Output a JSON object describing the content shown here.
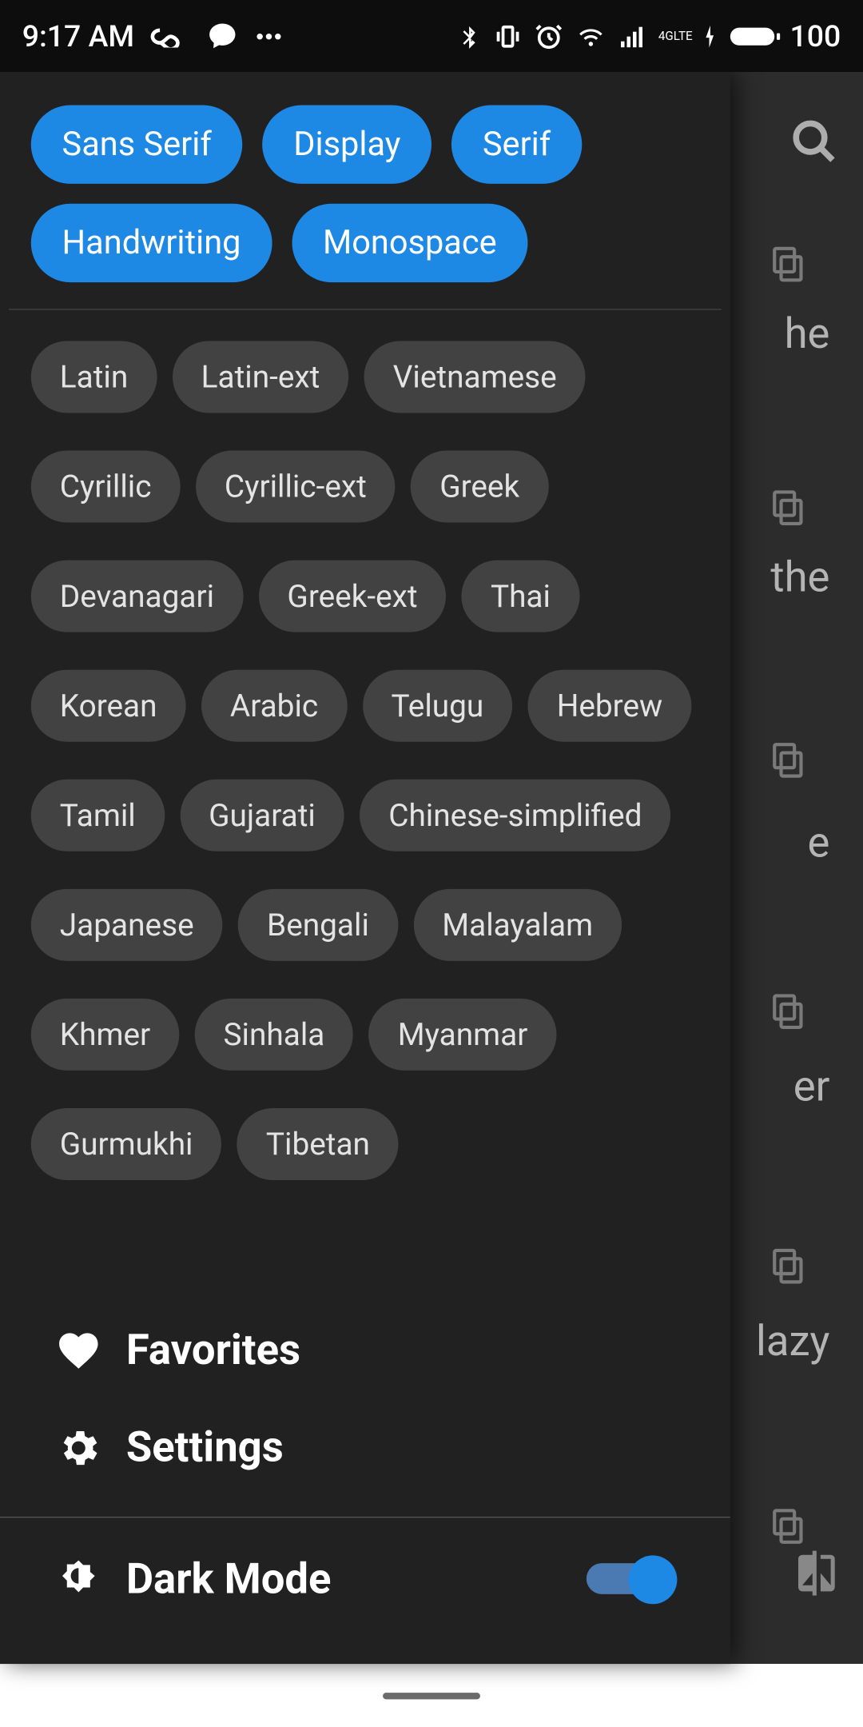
{
  "status_bar": {
    "time": "9:17 AM",
    "battery_pct": "100",
    "network_label_top": "4G",
    "network_label_bottom": "LTE"
  },
  "drawer": {
    "categories": [
      "Sans Serif",
      "Display",
      "Serif",
      "Handwriting",
      "Monospace"
    ],
    "scripts": [
      "Latin",
      "Latin-ext",
      "Vietnamese",
      "Cyrillic",
      "Cyrillic-ext",
      "Greek",
      "Devanagari",
      "Greek-ext",
      "Thai",
      "Korean",
      "Arabic",
      "Telugu",
      "Hebrew",
      "Tamil",
      "Gujarati",
      "Chinese-simplified",
      "Japanese",
      "Bengali",
      "Malayalam",
      "Khmer",
      "Sinhala",
      "Myanmar",
      "Gurmukhi",
      "Tibetan"
    ],
    "menu": {
      "favorites": "Favorites",
      "settings": "Settings",
      "dark_mode": "Dark Mode"
    },
    "dark_mode_enabled": true
  },
  "background": {
    "fragments": [
      "he",
      "the",
      "e",
      "er",
      "lazy"
    ]
  }
}
